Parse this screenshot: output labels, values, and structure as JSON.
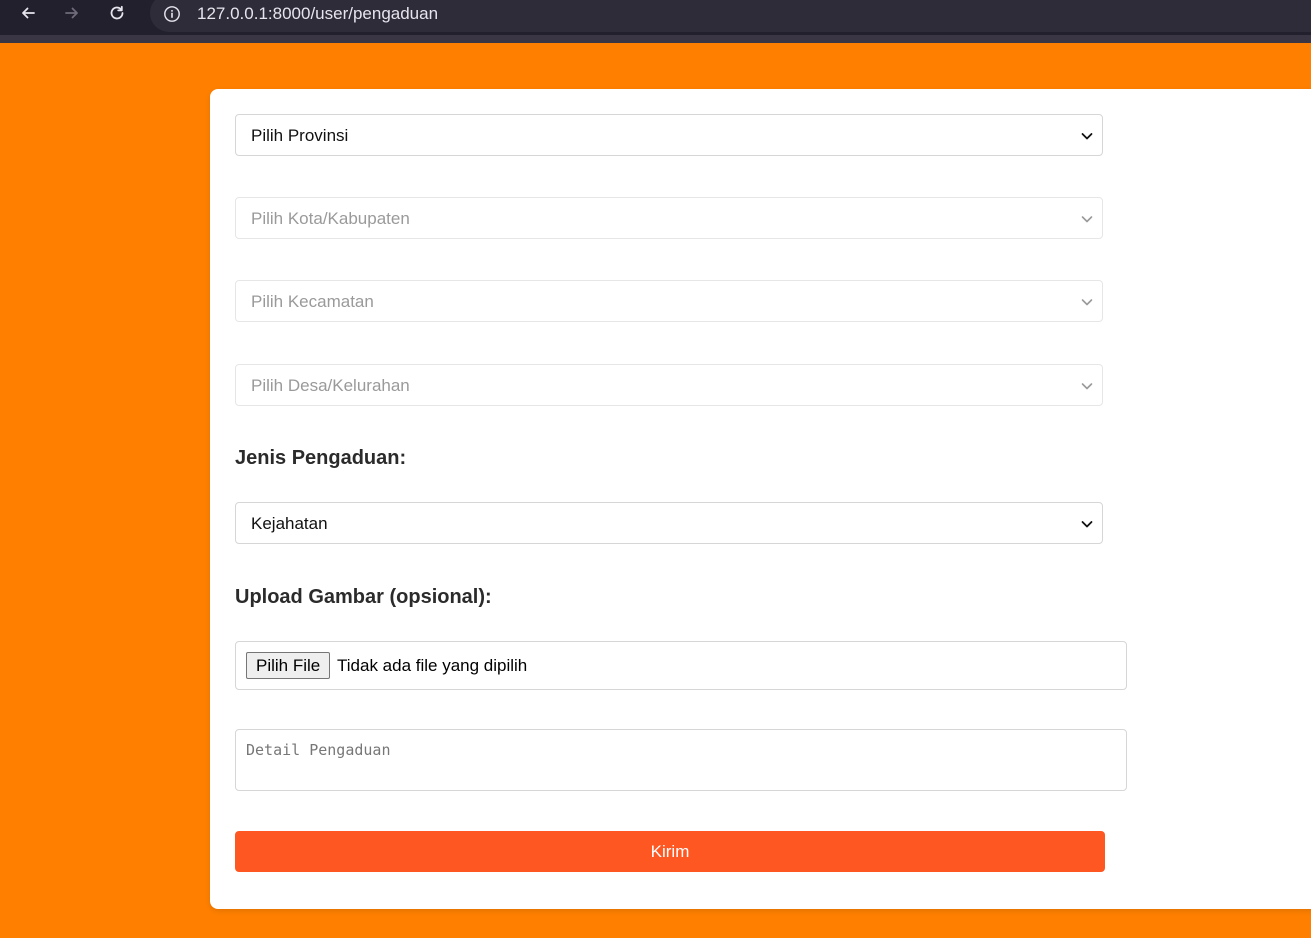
{
  "browser": {
    "url": "127.0.0.1:8000/user/pengaduan"
  },
  "form": {
    "provinsi_value": "Pilih Provinsi",
    "kota_value": "Pilih Kota/Kabupaten",
    "kecamatan_value": "Pilih Kecamatan",
    "desa_value": "Pilih Desa/Kelurahan",
    "jenis_label": "Jenis Pengaduan:",
    "jenis_value": "Kejahatan",
    "upload_label": "Upload Gambar (opsional):",
    "file_button_label": "Pilih File",
    "file_status": "Tidak ada file yang dipilih",
    "detail_placeholder": "Detail Pengaduan",
    "submit_label": "Kirim"
  },
  "colors": {
    "page_background": "#ff8000",
    "submit_background": "#ff5722",
    "browser_bar": "#23202e"
  },
  "icons": {
    "back": "arrow-left-icon",
    "forward": "arrow-right-icon",
    "reload": "reload-icon",
    "site_info": "info-icon",
    "dropdown": "chevron-down-icon"
  }
}
